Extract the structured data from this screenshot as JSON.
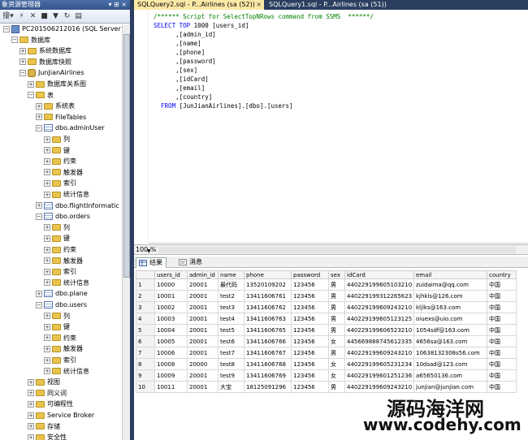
{
  "object_explorer": {
    "title": "象资源管理器",
    "toolbar_label": "接▾",
    "nodes": [
      {
        "label": "PC201506212016 (SQL Server 12",
        "icon": "server-icon"
      },
      {
        "label": "数据库",
        "icon": "folder-icon"
      },
      {
        "label": "系统数据库",
        "icon": "folder-icon"
      },
      {
        "label": "数据库快照",
        "icon": "folder-icon"
      },
      {
        "label": "JunJianAirlines",
        "icon": "database-icon"
      },
      {
        "label": "数据库关系图",
        "icon": "folder-icon"
      },
      {
        "label": "表",
        "icon": "folder-icon"
      },
      {
        "label": "系统表",
        "icon": "folder-icon"
      },
      {
        "label": "FileTables",
        "icon": "folder-icon"
      },
      {
        "label": "dbo.adminUser",
        "icon": "table-icon"
      },
      {
        "label": "列",
        "icon": "folder-icon"
      },
      {
        "label": "键",
        "icon": "folder-icon"
      },
      {
        "label": "约束",
        "icon": "folder-icon"
      },
      {
        "label": "触发器",
        "icon": "folder-icon"
      },
      {
        "label": "索引",
        "icon": "folder-icon"
      },
      {
        "label": "统计信息",
        "icon": "folder-icon"
      },
      {
        "label": "dbo.flightInformatic",
        "icon": "table-icon"
      },
      {
        "label": "dbo.orders",
        "icon": "table-icon"
      },
      {
        "label": "列",
        "icon": "folder-icon"
      },
      {
        "label": "键",
        "icon": "folder-icon"
      },
      {
        "label": "约束",
        "icon": "folder-icon"
      },
      {
        "label": "触发器",
        "icon": "folder-icon"
      },
      {
        "label": "索引",
        "icon": "folder-icon"
      },
      {
        "label": "统计信息",
        "icon": "folder-icon"
      },
      {
        "label": "dbo.plane",
        "icon": "table-icon"
      },
      {
        "label": "dbo.users",
        "icon": "table-icon"
      },
      {
        "label": "列",
        "icon": "folder-icon"
      },
      {
        "label": "键",
        "icon": "folder-icon"
      },
      {
        "label": "约束",
        "icon": "folder-icon"
      },
      {
        "label": "触发器",
        "icon": "folder-icon"
      },
      {
        "label": "索引",
        "icon": "folder-icon"
      },
      {
        "label": "统计信息",
        "icon": "folder-icon"
      },
      {
        "label": "视图",
        "icon": "folder-icon"
      },
      {
        "label": "同义词",
        "icon": "folder-icon"
      },
      {
        "label": "可编程性",
        "icon": "folder-icon"
      },
      {
        "label": "Service Broker",
        "icon": "folder-icon"
      },
      {
        "label": "存储",
        "icon": "folder-icon"
      },
      {
        "label": "安全性",
        "icon": "folder-icon"
      }
    ]
  },
  "tabs": [
    {
      "label": "SQLQuery2.sql - P...Airlines (sa (52))",
      "close": "×"
    },
    {
      "label": "SQLQuery1.sql - P...Airlines (sa (51))"
    }
  ],
  "editor": {
    "lines": [
      "/****** Script for SelectTopNRows command from SSMS  ******/",
      "SELECT TOP 1000 [users_id]",
      "      ,[admin_id]",
      "      ,[name]",
      "      ,[phone]",
      "      ,[password]",
      "      ,[sex]",
      "      ,[idCard]",
      "      ,[email]",
      "      ,[country]",
      "  FROM [JunJianAirlines].[dbo].[users]"
    ]
  },
  "zoom": "100 %",
  "results_tabs": {
    "results": "结果",
    "messages": "消息"
  },
  "grid": {
    "columns": [
      "users_id",
      "admin_id",
      "name",
      "phone",
      "password",
      "sex",
      "idCard",
      "email",
      "country"
    ],
    "rows": [
      [
        "1",
        "10000",
        "20001",
        "最代码",
        "13520109202",
        "123456",
        "男",
        "440229199605103210",
        "zuidaima@qq.com",
        "中国"
      ],
      [
        "2",
        "10001",
        "20001",
        "test2",
        "13411606761",
        "123456",
        "男",
        "440229199312265623",
        "kjhkls@126.com",
        "中国"
      ],
      [
        "3",
        "10002",
        "20001",
        "test3",
        "13411606762",
        "123456",
        "男",
        "440229199609243210",
        "kljlks@163.com",
        "中国"
      ],
      [
        "4",
        "10003",
        "20001",
        "test4",
        "13411606763",
        "123456",
        "男",
        "440229199605123125",
        "oiuexs@uio.com",
        "中国"
      ],
      [
        "5",
        "10004",
        "20001",
        "test5",
        "13411606765",
        "123456",
        "男",
        "440229199606523210",
        "1054sdf@163.com",
        "中国"
      ],
      [
        "6",
        "10005",
        "20001",
        "test6",
        "13411606766",
        "123456",
        "女",
        "445669888745612335",
        "4656sa@163.com",
        "中国"
      ],
      [
        "7",
        "10006",
        "20001",
        "test7",
        "13411606767",
        "123456",
        "男",
        "440229199609243210",
        "10638132308s56.com",
        "中国"
      ],
      [
        "8",
        "10008",
        "20000",
        "test8",
        "13411606768",
        "123456",
        "女",
        "440229199605231234",
        "10dsad@123.com",
        "中国"
      ],
      [
        "9",
        "10009",
        "20001",
        "test9",
        "13411606769",
        "123456",
        "女",
        "440229199601251236",
        "a65650136.com",
        "中国"
      ],
      [
        "10",
        "10011",
        "20001",
        "大宝",
        "18125091296",
        "123456",
        "男",
        "440229199609243210",
        "junjian@junjian.com",
        "中国"
      ]
    ]
  },
  "watermark": {
    "line1": "源码海洋网",
    "line2": "www.codehy.com"
  }
}
